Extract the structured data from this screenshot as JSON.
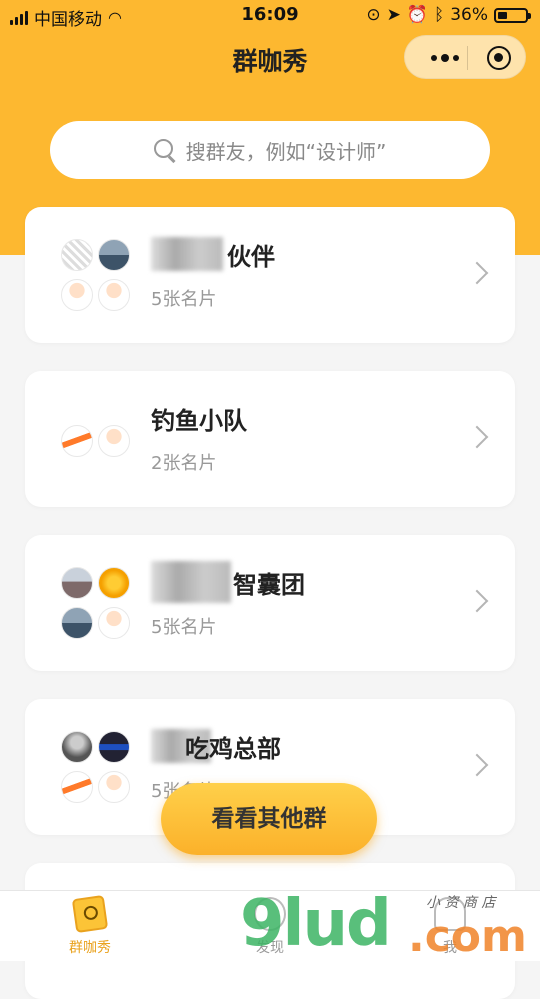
{
  "status_bar": {
    "carrier": "中国移动",
    "time": "16:09",
    "battery": "36%",
    "battery_level": 0.36
  },
  "nav": {
    "title": "群咖秀",
    "icons": [
      "more-icon",
      "close-target-icon"
    ]
  },
  "search": {
    "placeholder": "搜群友，例如“设计师”"
  },
  "groups": [
    {
      "name_visible": "伙伴",
      "count": "5张名片",
      "avatars": [
        "qr-code",
        "lake",
        "cartoon",
        "cartoon"
      ]
    },
    {
      "name_visible": "钓鱼小队",
      "count": "2张名片",
      "avatars": [
        "carrot",
        "cartoon"
      ]
    },
    {
      "name_visible": "智囊团",
      "count": "5张名片",
      "avatars": [
        "city",
        "sun",
        "lake",
        "cartoon"
      ]
    },
    {
      "name_visible": "吃鸡总部",
      "count": "5张名片",
      "avatars": [
        "person",
        "blue",
        "carrot",
        "cartoon"
      ]
    }
  ],
  "cta": {
    "label": "看看其他群"
  },
  "tabbar": {
    "items": [
      {
        "label": "群咖秀",
        "active": true,
        "color": "#e9a21e"
      },
      {
        "label": "发现",
        "active": false,
        "color": "#999999"
      },
      {
        "label": "我",
        "active": false,
        "color": "#999999"
      }
    ]
  },
  "watermark": {
    "text": "9lud",
    "domain": ".com",
    "tag": "小 资 商 店"
  },
  "colors": {
    "accent": "#fdb830",
    "background": "#f5f5f5"
  }
}
